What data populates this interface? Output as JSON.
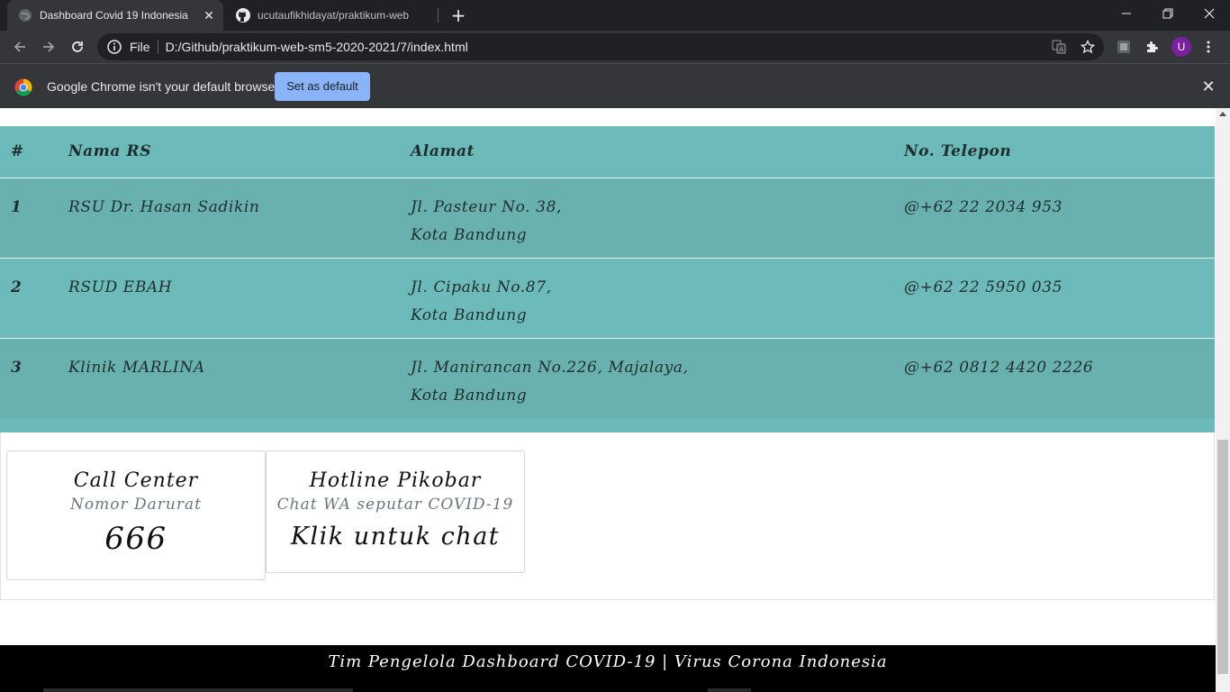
{
  "browser": {
    "tabs": [
      {
        "title": "Dashboard Covid 19 Indonesia",
        "active": true,
        "icon": "globe-icon"
      },
      {
        "title": "ucutaufikhidayat/praktikum-web",
        "active": false,
        "icon": "github-icon"
      }
    ],
    "new_tab_label": "+",
    "omnibox": {
      "scheme": "File",
      "url": "D:/Github/praktikum-web-sm5-2020-2021/7/index.html"
    },
    "avatar_letter": "U",
    "infobar": {
      "message": "Google Chrome isn't your default browser",
      "button": "Set as default"
    }
  },
  "table": {
    "headers": [
      "#",
      "Nama RS",
      "Alamat",
      "No. Telepon"
    ],
    "rows": [
      {
        "no": "1",
        "nama": "RSU Dr. Hasan Sadikin",
        "alamat1": "Jl. Pasteur No. 38,",
        "alamat2": "Kota Bandung",
        "telp": "@+62 22 2034 953"
      },
      {
        "no": "2",
        "nama": "RSUD EBAH",
        "alamat1": "Jl. Cipaku No.87,",
        "alamat2": "Kota Bandung",
        "telp": "@+62 22 5950 035"
      },
      {
        "no": "3",
        "nama": "Klinik MARLINA",
        "alamat1": "Jl. Manirancan No.226, Majalaya,",
        "alamat2": "Kota Bandung",
        "telp": "@+62 0812 4420 2226"
      }
    ]
  },
  "cards": [
    {
      "title": "Call Center",
      "subtitle": "Nomor Darurat",
      "value": "666"
    },
    {
      "title": "Hotline Pikobar",
      "subtitle": "Chat WA seputar COVID-19",
      "value": "Klik untuk chat"
    }
  ],
  "footer": {
    "text": "Tim Pengelola Dashboard COVID-19 | Virus Corona Indonesia"
  },
  "colors": {
    "table_bg": "#6cbab9",
    "table_row_alt": "#69b1af",
    "chrome_dark": "#202124",
    "chrome_toolbar": "#35363a",
    "infobar_button": "#8ab4f8"
  }
}
